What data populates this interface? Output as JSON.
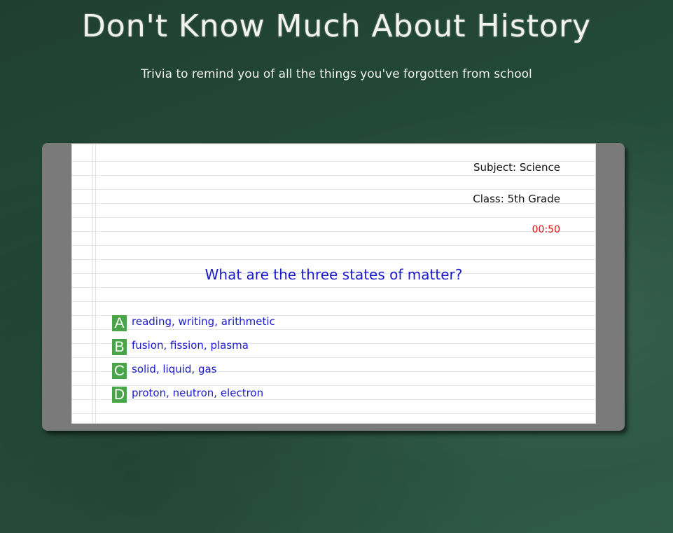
{
  "header": {
    "title": "Don't Know Much About History",
    "subtitle": "Trivia to remind you of all the things you've forgotten from school"
  },
  "quiz": {
    "subject": "Subject: Science",
    "class": "Class: 5th Grade",
    "timer": "00:50",
    "question": "What are the three states of matter?",
    "answers": [
      {
        "letter": "A",
        "text": "reading, writing, arithmetic"
      },
      {
        "letter": "B",
        "text": "fusion, fission, plasma"
      },
      {
        "letter": "C",
        "text": "solid, liquid, gas"
      },
      {
        "letter": "D",
        "text": "proton, neutron, electron"
      }
    ]
  },
  "colors": {
    "background": "#234a39",
    "frame": "#7a7a7a",
    "question_text": "#1a1acc",
    "timer": "#e01010",
    "answer_badge": "#4aa54a"
  }
}
